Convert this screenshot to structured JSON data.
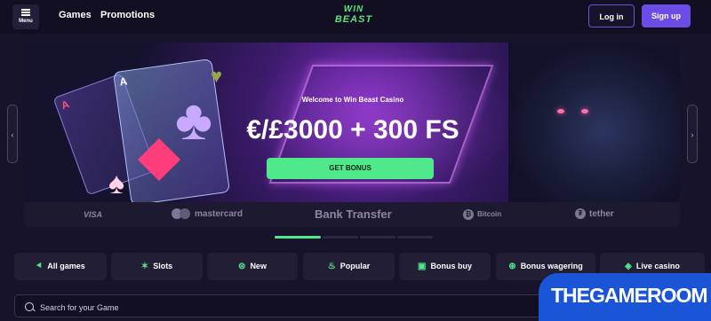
{
  "header": {
    "menu_label": "Menu",
    "nav": [
      "Games",
      "Promotions"
    ],
    "logo_line1": "WIN",
    "logo_line2": "BEAST",
    "login_label": "Log in",
    "signup_label": "Sign up"
  },
  "banner": {
    "welcome": "Welcome to Win Beast Casino",
    "headline": "€/£3000 + 300 FS",
    "cta_label": "GET BONUS",
    "card_rank": "A",
    "prev_arrow": "‹",
    "next_arrow": "›"
  },
  "payments": [
    "VISA",
    "mastercard",
    "Bank Transfer",
    "Bitcoin",
    "tether"
  ],
  "carousel": {
    "slides": 4,
    "active": 1
  },
  "categories": [
    {
      "label": "All games",
      "icon": "gamepad-icon",
      "glyph": "⯇"
    },
    {
      "label": "Slots",
      "icon": "slots-icon",
      "glyph": "✶"
    },
    {
      "label": "New",
      "icon": "new-icon",
      "glyph": "⊜"
    },
    {
      "label": "Popular",
      "icon": "flame-icon",
      "glyph": "♨"
    },
    {
      "label": "Bonus buy",
      "icon": "gift-icon",
      "glyph": "▣"
    },
    {
      "label": "Bonus wagering",
      "icon": "wagering-icon",
      "glyph": "⊛"
    },
    {
      "label": "Live casino",
      "icon": "live-casino-icon",
      "glyph": "◈"
    }
  ],
  "search": {
    "placeholder": "Search for your Game"
  },
  "watermark": "THEGAMEROOM",
  "colors": {
    "accent_green": "#4fe88a",
    "primary_purple": "#6b4de6",
    "background": "#17132a"
  }
}
